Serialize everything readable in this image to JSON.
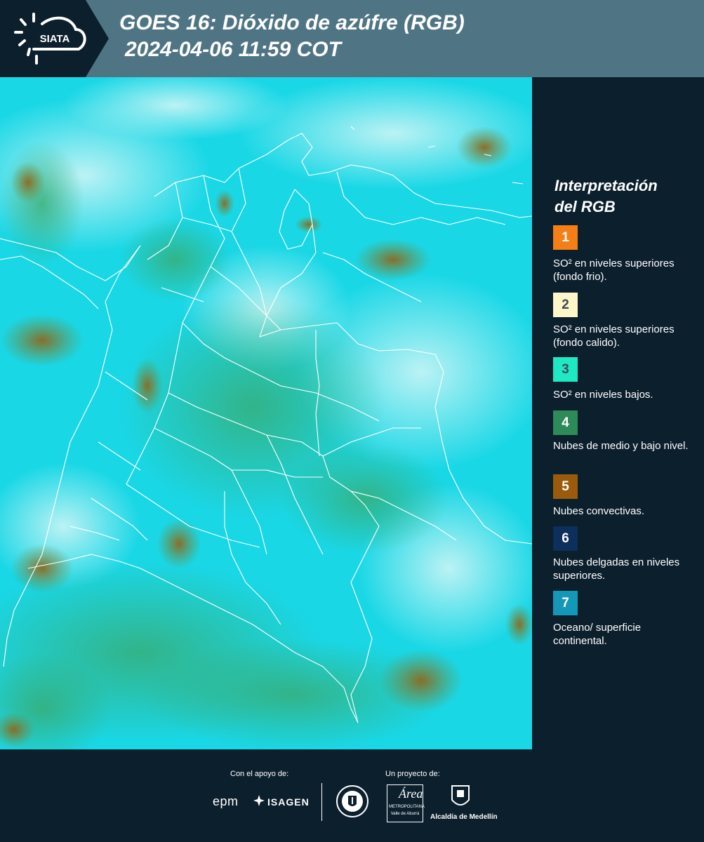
{
  "header": {
    "logo_text": "SIATA",
    "title_line1": "GOES 16: Dióxido de azúfre (RGB)",
    "title_line2": "2024-04-06 11:59 COT"
  },
  "legend": {
    "title_line1": "Interpretación",
    "title_line2": "del RGB",
    "items": [
      {
        "number": "1",
        "color": "#f57f17",
        "label": "SO² en niveles superiores (fondo frio)."
      },
      {
        "number": "2",
        "color": "#fff6c9",
        "label": "SO² en niveles superiores (fondo calido)."
      },
      {
        "number": "3",
        "color": "#1fe8c4",
        "label": "SO² en niveles bajos."
      },
      {
        "number": "4",
        "color": "#2f8a5a",
        "label": "Nubes de medio y bajo nivel."
      },
      {
        "number": "5",
        "color": "#9a5c0c",
        "label": "Nubes convectivas."
      },
      {
        "number": "6",
        "color": "#0c2f5c",
        "label": "Nubes delgadas en niveles superiores."
      },
      {
        "number": "7",
        "color": "#1597b8",
        "label": "Oceano/ superficie continental."
      }
    ]
  },
  "footer": {
    "support_label": "Con el apoyo de:",
    "project_label": "Un proyecto de:",
    "epm": "epm",
    "isagen": "ISAGEN",
    "area_name": "Área",
    "area_sub1": "METROPOLITANA",
    "area_sub2": "Valle de Aburrá",
    "alcaldia": "Alcaldía de Medellín",
    "seal_text": "MEDELLÍN"
  },
  "colors": {
    "header_bg": "#4f7585",
    "panel_bg": "#0c1f2d",
    "map_cyan": "#1ad7e6",
    "map_haze": "#bff4f5"
  }
}
